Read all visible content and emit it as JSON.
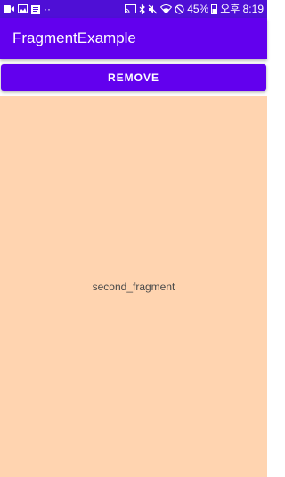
{
  "status_bar": {
    "battery_text": "45%",
    "time_text": "오후 8:19",
    "left_extra": "··",
    "icons_left": [
      "video-call-icon",
      "image-icon",
      "clipboard-icon"
    ],
    "icons_right": [
      "cast-icon",
      "bluetooth-icon",
      "mute-icon",
      "wifi-icon",
      "no-signal-icon",
      "battery-icon"
    ]
  },
  "app_bar": {
    "title": "FragmentExample"
  },
  "toolbar": {
    "remove_label": "REMOVE"
  },
  "fragment": {
    "label": "second_fragment"
  },
  "colors": {
    "status_bar": "#4f0fd6",
    "primary": "#6200ee",
    "fragment_background": "#ffd4b0"
  }
}
